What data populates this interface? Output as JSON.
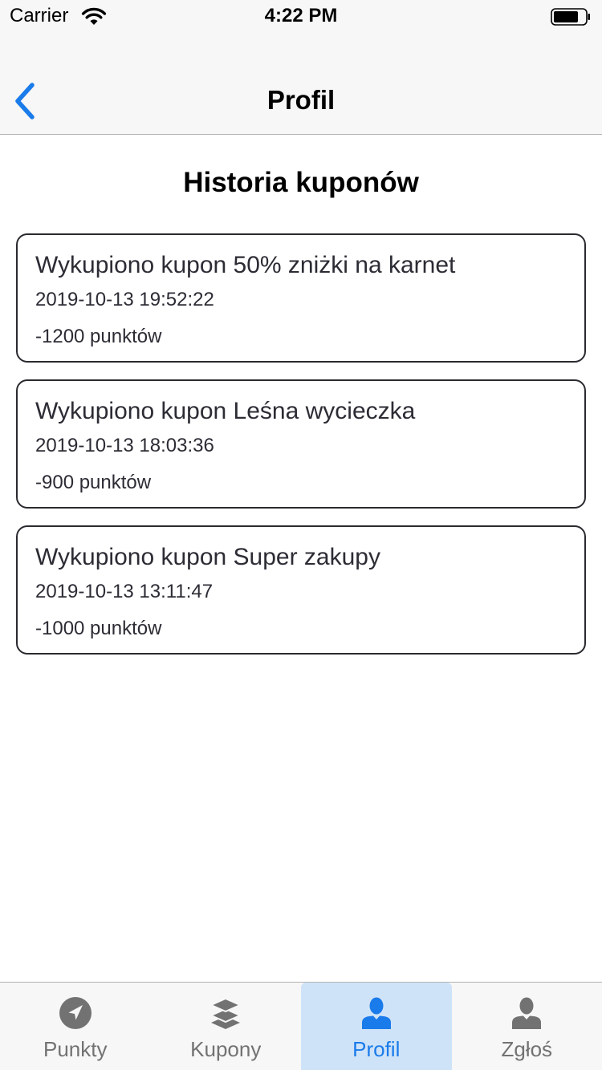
{
  "status_bar": {
    "carrier": "Carrier",
    "time": "4:22 PM",
    "wifi_icon": "wifi-icon",
    "battery_icon": "battery-icon"
  },
  "nav": {
    "title": "Profil",
    "back_icon": "chevron-left-icon"
  },
  "section": {
    "title": "Historia kuponów"
  },
  "coupons": [
    {
      "title": "Wykupiono kupon 50% zniżki na karnet",
      "date": "2019-10-13 19:52:22",
      "points": "-1200 punktów"
    },
    {
      "title": "Wykupiono kupon Leśna wycieczka",
      "date": "2019-10-13 18:03:36",
      "points": "-900 punktów"
    },
    {
      "title": "Wykupiono kupon Super zakupy",
      "date": "2019-10-13 13:11:47",
      "points": "-1000 punktów"
    }
  ],
  "tabs": [
    {
      "label": "Punkty",
      "icon": "location-arrow-icon",
      "active": false
    },
    {
      "label": "Kupony",
      "icon": "layers-icon",
      "active": false
    },
    {
      "label": "Profil",
      "icon": "user-icon",
      "active": true
    },
    {
      "label": "Zgłoś",
      "icon": "user-icon",
      "active": false
    }
  ],
  "colors": {
    "accent": "#1a7bea",
    "active_tab_bg": "#cfe3f8",
    "inactive_tab": "#727272",
    "card_border": "#2a2a30"
  }
}
